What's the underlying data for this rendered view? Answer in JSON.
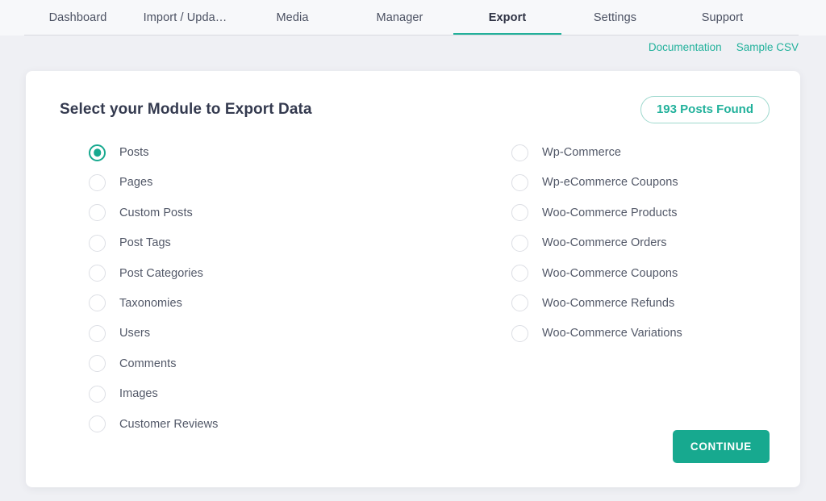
{
  "nav": {
    "tabs": [
      {
        "label": "Dashboard",
        "active": false
      },
      {
        "label": "Import / Upda…",
        "active": false
      },
      {
        "label": "Media",
        "active": false
      },
      {
        "label": "Manager",
        "active": false
      },
      {
        "label": "Export",
        "active": true
      },
      {
        "label": "Settings",
        "active": false
      },
      {
        "label": "Support",
        "active": false
      }
    ],
    "active_underline_color": "#22b09a"
  },
  "quicklinks": [
    {
      "label": "Documentation"
    },
    {
      "label": "Sample CSV"
    }
  ],
  "card": {
    "title": "Select your Module to Export Data",
    "badge": "193 Posts Found",
    "badge_color": "#21b19b"
  },
  "modules": {
    "left": [
      {
        "label": "Posts",
        "selected": true
      },
      {
        "label": "Pages",
        "selected": false
      },
      {
        "label": "Custom Posts",
        "selected": false
      },
      {
        "label": "Post Tags",
        "selected": false
      },
      {
        "label": "Post Categories",
        "selected": false
      },
      {
        "label": "Taxonomies",
        "selected": false
      },
      {
        "label": "Users",
        "selected": false
      },
      {
        "label": "Comments",
        "selected": false
      },
      {
        "label": "Images",
        "selected": false
      },
      {
        "label": "Customer Reviews",
        "selected": false
      }
    ],
    "right": [
      {
        "label": "Wp-Commerce",
        "selected": false
      },
      {
        "label": "Wp-eCommerce Coupons",
        "selected": false
      },
      {
        "label": "Woo-Commerce Products",
        "selected": false
      },
      {
        "label": "Woo-Commerce Orders",
        "selected": false
      },
      {
        "label": "Woo-Commerce Coupons",
        "selected": false
      },
      {
        "label": "Woo-Commerce Refunds",
        "selected": false
      },
      {
        "label": "Woo-Commerce Variations",
        "selected": false
      }
    ]
  },
  "footer": {
    "continue_label": "CONTINUE",
    "continue_color": "#17a98f"
  }
}
